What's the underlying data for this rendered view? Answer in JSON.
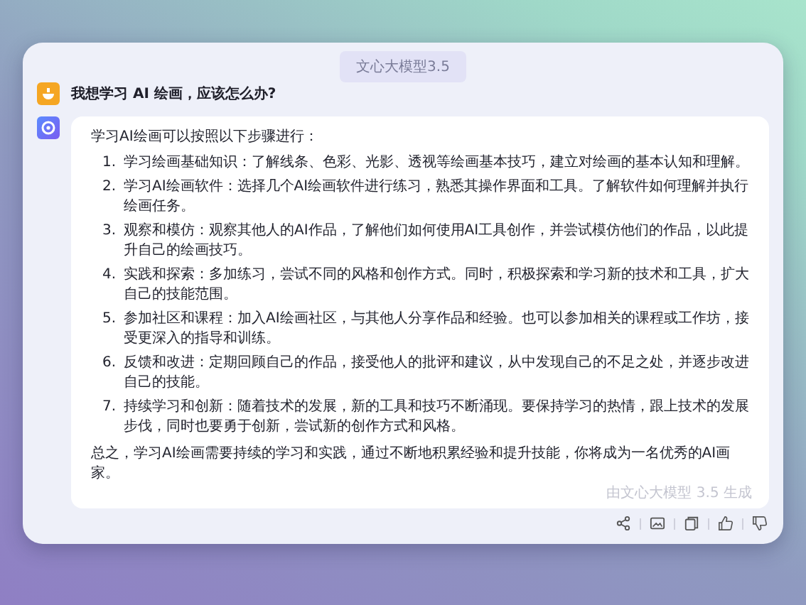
{
  "model_tag": "文心大模型3.5",
  "question": "我想学习 AI 绘画，应该怎么办?",
  "answer": {
    "intro": "学习AI绘画可以按照以下步骤进行：",
    "steps": [
      {
        "number": "1.",
        "text": "学习绘画基础知识：了解线条、色彩、光影、透视等绘画基本技巧，建立对绘画的基本认知和理解。"
      },
      {
        "number": "2.",
        "text": "学习AI绘画软件：选择几个AI绘画软件进行练习，熟悉其操作界面和工具。了解软件如何理解并执行绘画任务。"
      },
      {
        "number": "3.",
        "text": "观察和模仿：观察其他人的AI作品，了解他们如何使用AI工具创作，并尝试模仿他们的作品，以此提升自己的绘画技巧。"
      },
      {
        "number": "4.",
        "text": "实践和探索：多加练习，尝试不同的风格和创作方式。同时，积极探索和学习新的技术和工具，扩大自己的技能范围。"
      },
      {
        "number": "5.",
        "text": "参加社区和课程：加入AI绘画社区，与其他人分享作品和经验。也可以参加相关的课程或工作坊，接受更深入的指导和训练。"
      },
      {
        "number": "6.",
        "text": "反馈和改进：定期回顾自己的作品，接受他人的批评和建议，从中发现自己的不足之处，并逐步改进自己的技能。"
      },
      {
        "number": "7.",
        "text": "持续学习和创新：随着技术的发展，新的工具和技巧不断涌现。要保持学习的热情，跟上技术的发展步伐，同时也要勇于创新，尝试新的创作方式和风格。"
      }
    ],
    "conclusion": "总之，学习AI绘画需要持续的学习和实践，通过不断地积累经验和提升技能，你将成为一名优秀的AI画家。",
    "footer_note": "由文心大模型 3.5 生成"
  },
  "actions": [
    {
      "kind": "share"
    },
    {
      "kind": "image"
    },
    {
      "kind": "copy"
    },
    {
      "kind": "like"
    },
    {
      "kind": "dislike"
    }
  ]
}
